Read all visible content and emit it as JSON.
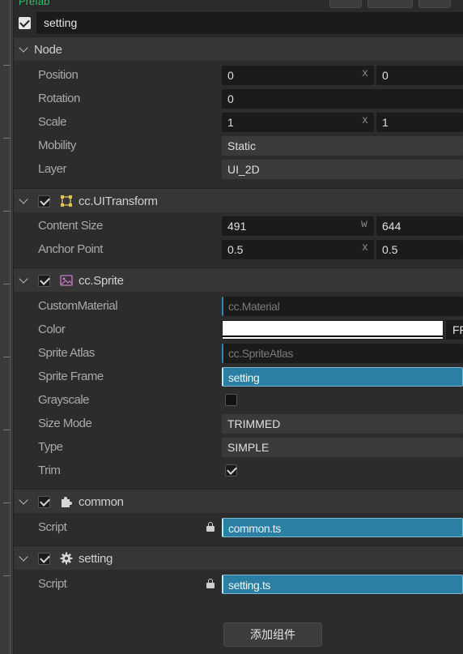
{
  "topbar": {
    "prefab_label": "Prefab"
  },
  "node": {
    "name": "setting",
    "active": true
  },
  "sections": {
    "node": {
      "title": "Node",
      "position": {
        "label": "Position",
        "x": "0",
        "y": "0",
        "x_axis": "x"
      },
      "rotation": {
        "label": "Rotation",
        "value": "0"
      },
      "scale": {
        "label": "Scale",
        "x": "1",
        "y": "1",
        "x_axis": "x"
      },
      "mobility": {
        "label": "Mobility",
        "value": "Static"
      },
      "layer": {
        "label": "Layer",
        "value": "UI_2D"
      }
    },
    "uitransform": {
      "title": "cc.UITransform",
      "content_size": {
        "label": "Content Size",
        "w": "491",
        "h": "644",
        "axis": "w"
      },
      "anchor_point": {
        "label": "Anchor Point",
        "x": "0.5",
        "y": "0.5",
        "axis": "x"
      }
    },
    "sprite": {
      "title": "cc.Sprite",
      "custom_material": {
        "label": "CustomMaterial",
        "value": "cc.Material"
      },
      "color": {
        "label": "Color",
        "button": "FF"
      },
      "sprite_atlas": {
        "label": "Sprite Atlas",
        "value": "cc.SpriteAtlas"
      },
      "sprite_frame": {
        "label": "Sprite Frame",
        "value": "setting"
      },
      "grayscale": {
        "label": "Grayscale",
        "checked": false
      },
      "size_mode": {
        "label": "Size Mode",
        "value": "TRIMMED"
      },
      "type": {
        "label": "Type",
        "value": "SIMPLE"
      },
      "trim": {
        "label": "Trim",
        "checked": true
      }
    },
    "common": {
      "title": "common",
      "script": {
        "label": "Script",
        "value": "common.ts"
      }
    },
    "setting": {
      "title": "setting",
      "script": {
        "label": "Script",
        "value": "setting.ts"
      }
    }
  },
  "add_component_label": "添加组件",
  "colors": {
    "accent_blue": "#2b7fa3",
    "prefab_green": "#2fbf71",
    "panel_bg": "#2c2c2c"
  }
}
